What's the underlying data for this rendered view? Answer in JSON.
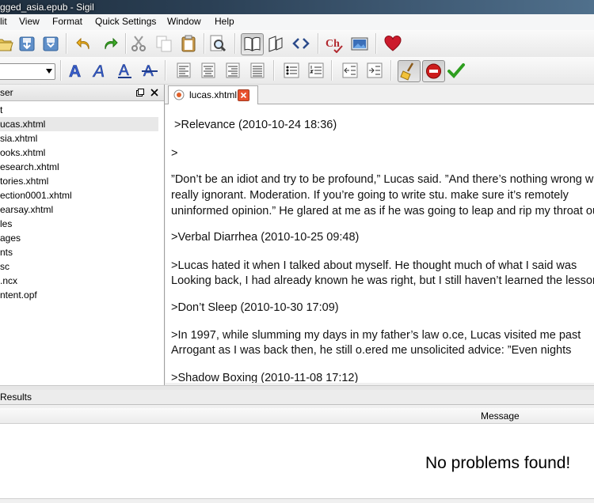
{
  "window": {
    "title": "gged_asia.epub - Sigil"
  },
  "menu": [
    "lit",
    "View",
    "Format",
    "Quick Settings",
    "Window",
    "Help"
  ],
  "colors": {
    "heart": "#cc1a2c",
    "check": "#2e9e1f",
    "stop": "#cc1c1c",
    "link": "#3a5fcd"
  },
  "toolbar": {
    "row1_icons": [
      "open-icon",
      "save-icon",
      "save-as-icon",
      "undo-icon",
      "redo-icon",
      "cut-icon",
      "copy-icon",
      "paste-icon",
      "find-icon",
      "book-view-icon",
      "split-view-icon",
      "code-view-icon",
      "spellcheck-icon",
      "image-icon",
      "donate-heart-icon"
    ],
    "row2_icons": [
      "bold-a-icon",
      "italic-a-icon",
      "underline-a-icon",
      "strike-a-icon",
      "align-left-icon",
      "align-center-icon",
      "align-right-icon",
      "justify-icon",
      "bullet-list-icon",
      "numbered-list-icon",
      "outdent-icon",
      "indent-icon",
      "clean-icon",
      "stop-icon",
      "check-icon"
    ]
  },
  "sidebar": {
    "title": "ser",
    "items": [
      "t",
      "ucas.xhtml",
      "sia.xhtml",
      "ooks.xhtml",
      "esearch.xhtml",
      "tories.xhtml",
      "ection0001.xhtml",
      "earsay.xhtml",
      "les",
      "ages",
      "nts",
      "sc",
      ".ncx",
      "ntent.opf"
    ]
  },
  "tab": {
    "label": "lucas.xhtml"
  },
  "editor": {
    "lines": [
      ">Relevance (2010-10-24 18:36)",
      ">",
      "”Don’t be an idiot and try to be profound,” Lucas said. ”And there’s nothing wrong with being",
      "really ignorant. Moderation. If you’re going to write stu. make sure it’s remotely",
      "uninformed opinion.” He glared at me as if he was going to leap and rip my throat out.",
      ">Verbal Diarrhea (2010-10-25 09:48)",
      ">Lucas hated it when I talked about myself. He thought much of what I said was",
      "Looking back, I had already known he was right, but I still haven’t learned the lesson.",
      ">Don’t Sleep (2010-10-30 17:09)",
      ">In 1997, while slumming my days in my father’s law o.ce, Lucas visited me past",
      "Arrogant as I was back then, he still o.ered me unsolicited advice: ”Even nights",
      ">Shadow Boxing (2010-11-08 17:12)"
    ]
  },
  "results": {
    "title": "Results",
    "column_message": "Message",
    "status": "No problems found!"
  }
}
